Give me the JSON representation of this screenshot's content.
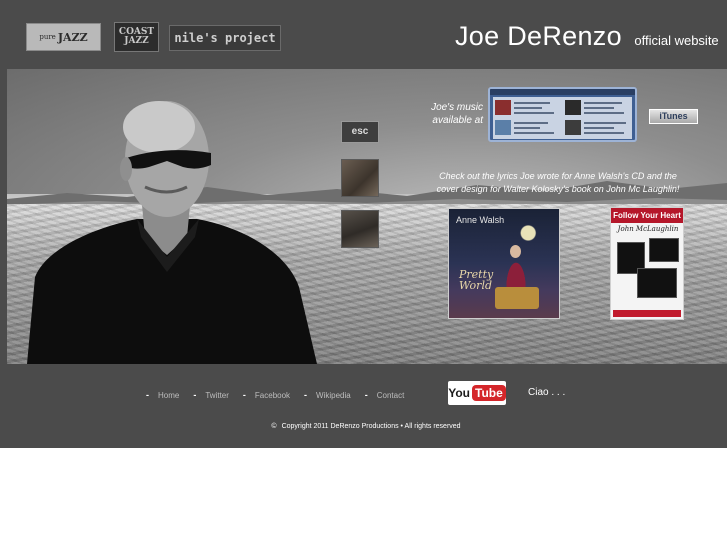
{
  "header": {
    "logos": {
      "pure_jazz_small": "pure",
      "pure_jazz": "JAZZ",
      "coast_line1": "COAST",
      "coast_line2": "JAZZ",
      "niles_project": "nile's project"
    },
    "site_name": "Joe DeRenzo",
    "site_subtitle": "official website"
  },
  "hero": {
    "esc_label": "esc",
    "music_label_line1": "Joe's music",
    "music_label_line2": "available at",
    "itunes_button": "iTunes",
    "lyrics_text": "Check out the lyrics Joe wrote for Anne Walsh's CD and the cover design for Walter Kolosky's book on John Mc Laughlin!",
    "album": {
      "artist": "Anne Walsh",
      "title_line1": "Pretty",
      "title_line2": "World"
    },
    "book": {
      "banner": "Follow Your Heart",
      "subject": "John McLaughlin"
    }
  },
  "footer": {
    "nav": [
      "Home",
      "Twitter",
      "Facebook",
      "Wikipedia",
      "Contact"
    ],
    "bullet": "-",
    "youtube_you": "You",
    "youtube_tube": "Tube",
    "ciao": "Ciao . . .",
    "copyright_symbol": "©",
    "copyright": "Copyright 2011 DeRenzo Productions • All rights reserved"
  },
  "colors": {
    "background": "#4b4b4b",
    "page_below": "#ffffff",
    "youtube_red": "#d4262a",
    "itunes_blue": "#3f5f92",
    "book_red": "#b5172a"
  },
  "icons": [
    "youtube-logo",
    "itunes-logo"
  ]
}
